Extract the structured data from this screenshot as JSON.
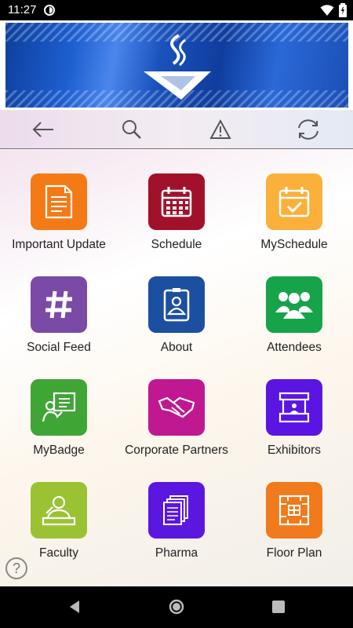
{
  "status_bar": {
    "time": "11:27"
  },
  "banner": {
    "logo": "torch-logo"
  },
  "toolbar": {
    "buttons": [
      {
        "name": "back",
        "icon": "arrow-left-icon"
      },
      {
        "name": "search",
        "icon": "search-icon"
      },
      {
        "name": "alert",
        "icon": "warning-icon"
      },
      {
        "name": "sync",
        "icon": "sync-icon"
      }
    ]
  },
  "tiles": [
    {
      "label": "Important Update",
      "color": "#f47a16",
      "icon": "document-icon"
    },
    {
      "label": "Schedule",
      "color": "#a1112a",
      "icon": "calendar-icon"
    },
    {
      "label": "MySchedule",
      "color": "#fbb03b",
      "icon": "calendar-check-icon"
    },
    {
      "label": "Social Feed",
      "color": "#7b4aa6",
      "icon": "hashtag-icon"
    },
    {
      "label": "About",
      "color": "#1d4fa0",
      "icon": "id-badge-icon"
    },
    {
      "label": "Attendees",
      "color": "#16a34a",
      "icon": "people-icon"
    },
    {
      "label": "MyBadge",
      "color": "#3fa535",
      "icon": "presenter-icon"
    },
    {
      "label": "Corporate Partners",
      "color": "#c01891",
      "icon": "handshake-icon"
    },
    {
      "label": "Exhibitors",
      "color": "#5b15e3",
      "icon": "booth-icon"
    },
    {
      "label": "Faculty",
      "color": "#9bc232",
      "icon": "speaker-icon"
    },
    {
      "label": "Pharma",
      "color": "#5b17e0",
      "icon": "files-icon"
    },
    {
      "label": "Floor Plan",
      "color": "#f07a1c",
      "icon": "floorplan-icon"
    }
  ],
  "help": {
    "label": "?"
  }
}
